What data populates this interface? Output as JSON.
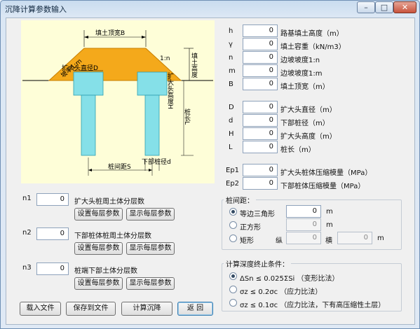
{
  "window": {
    "title": "沉降计算参数输入",
    "min": "–",
    "max": "□",
    "close": "✕"
  },
  "diagram": {
    "top_width": "填土顶宽B",
    "slope_left": "坡率1:m",
    "slope_right": "1:n",
    "fill_height": "填土高度",
    "cap_dia": "扩大头直径D",
    "cap_height": "扩大头高度H",
    "pile_length": "桩长L",
    "pile_spacing": "桩间距S",
    "lower_dia": "下部桩径d"
  },
  "params": [
    {
      "sym": "h",
      "value": "0",
      "label": "路基填土高度（m）"
    },
    {
      "sym": "γ",
      "value": "0",
      "label": "填土容重（kN/m3）"
    },
    {
      "sym": "n",
      "value": "0",
      "label": "边坡坡度1:n"
    },
    {
      "sym": "m",
      "value": "0",
      "label": "边坡坡度1:m"
    },
    {
      "sym": "B",
      "value": "0",
      "label": "填土顶宽（m）"
    },
    {
      "sym": "D",
      "value": "0",
      "label": "扩大头直径（m）"
    },
    {
      "sym": "d",
      "value": "0",
      "label": "下部桩径（m）"
    },
    {
      "sym": "H",
      "value": "0",
      "label": "扩大头高度（m）"
    },
    {
      "sym": "L",
      "value": "0",
      "label": "桩长（m）"
    },
    {
      "sym": "Ep1",
      "value": "0",
      "label": "扩大头桩体压缩模量（MPa）"
    },
    {
      "sym": "Ep2",
      "value": "0",
      "label": "下部桩体压缩模量（MPa）"
    }
  ],
  "layers": [
    {
      "sym": "n1",
      "value": "0",
      "label": "扩大头桩周土体分层数",
      "btn_set": "设置每层参数",
      "btn_show": "显示每层参数"
    },
    {
      "sym": "n2",
      "value": "0",
      "label": "下部桩体桩周土体分层数",
      "btn_set": "设置每层参数",
      "btn_show": "显示每层参数"
    },
    {
      "sym": "n3",
      "value": "0",
      "label": "桩端下部土体分层数",
      "btn_set": "设置每层参数",
      "btn_show": "显示每层参数"
    }
  ],
  "spacing": {
    "title": "桩间距：",
    "tri": "等边三角形",
    "tri_value": "0",
    "unit": "m",
    "square": "正方形",
    "square_value": "0",
    "rect": "矩形",
    "vertical": "纵",
    "vertical_value": "0",
    "horizontal": "横",
    "horizontal_value": "0"
  },
  "depth": {
    "title": "计算深度终止条件：",
    "options": [
      "ΔSn ≤ 0.025ΣSi （变形比法）",
      "σz ≤ 0.2σc （应力比法）",
      "σz ≤ 0.1σc （应力比法，下有高压缩性土层）"
    ]
  },
  "buttons": {
    "load": "载入文件",
    "save": "保存到文件",
    "calc": "计算沉降",
    "back": "返 回"
  }
}
